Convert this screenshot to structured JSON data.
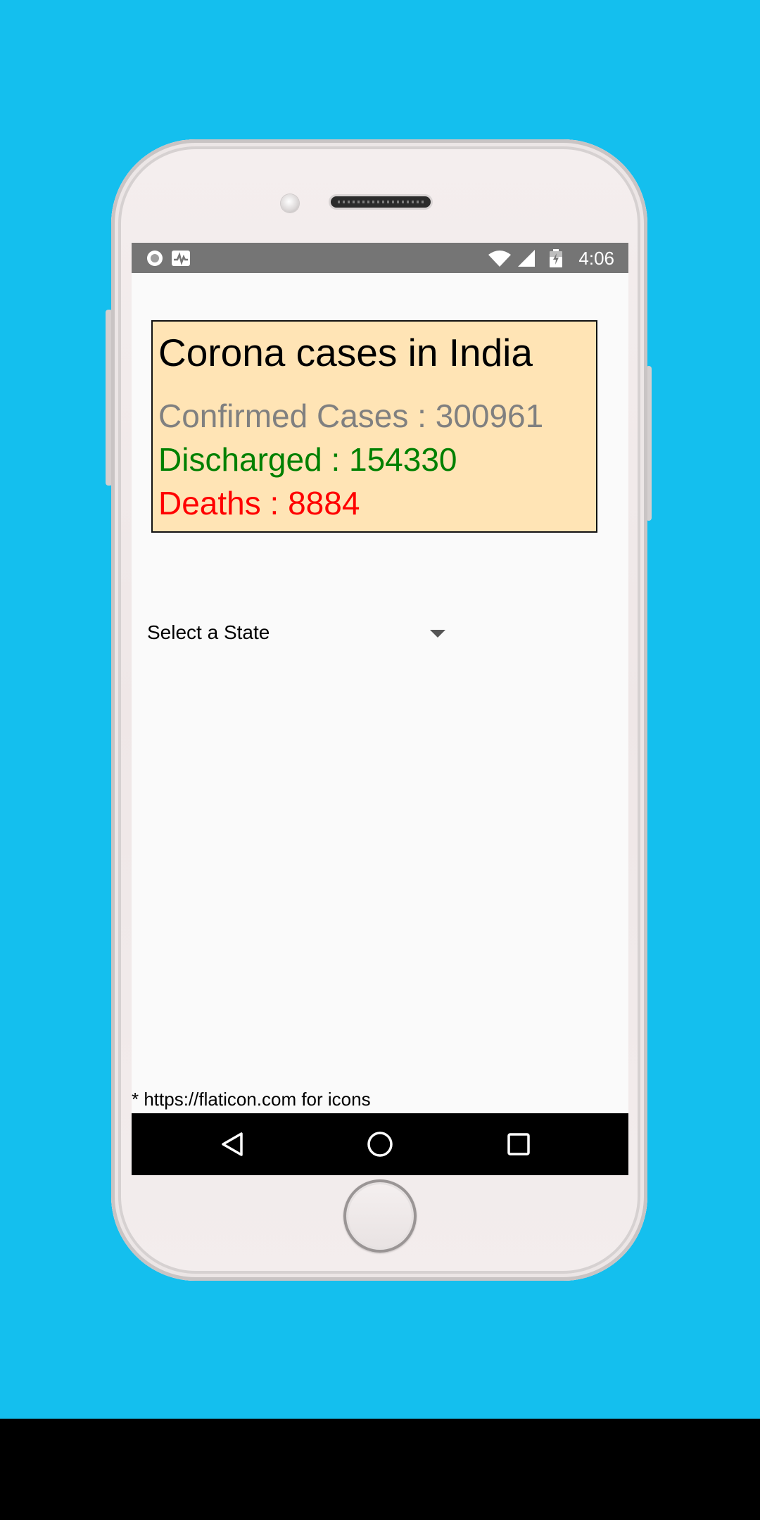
{
  "status_bar": {
    "time": "4:06",
    "left_icons": [
      "record-icon",
      "activity-icon"
    ],
    "right_icons": [
      "wifi-icon",
      "signal-icon",
      "battery-icon"
    ]
  },
  "card": {
    "title": "Corona cases in India",
    "confirmed": "Confirmed Cases : 300961",
    "discharged": "Discharged : 154330",
    "deaths": "Deaths : 8884",
    "background_color": "#ffe4b5",
    "confirmed_color": "#808080",
    "discharged_color": "#008000",
    "deaths_color": "#ff0000"
  },
  "state_spinner": {
    "selected": "Select a State"
  },
  "footer": {
    "note": "* https://flaticon.com for icons"
  },
  "nav_bar": {
    "icons": [
      "back-icon",
      "home-icon",
      "recents-icon"
    ]
  },
  "colors": {
    "backdrop": "#14bfee",
    "status_bar": "#757575"
  }
}
